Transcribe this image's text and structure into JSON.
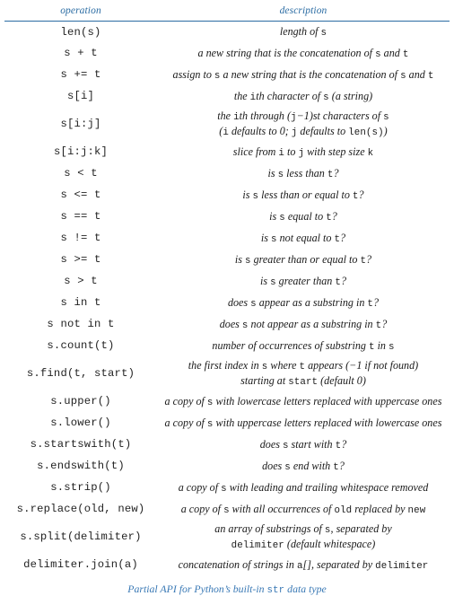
{
  "table": {
    "headers": {
      "operation": "operation",
      "description": "description"
    },
    "rows": [
      {
        "op": "len(s)",
        "desc_html": "length of <code class=\"m\">s</code>"
      },
      {
        "op": "s + t",
        "desc_html": "a new string that is the concatenation of <code class=\"m\">s</code> and <code class=\"m\">t</code>"
      },
      {
        "op": "s += t",
        "desc_html": "assign to <code class=\"m\">s</code> a new string that is the concatenation of <code class=\"m\">s</code> and <code class=\"m\">t</code>"
      },
      {
        "op": "s[i]",
        "desc_html": "the <code class=\"m\">i</code>th character of <code class=\"m\">s</code> (a string)"
      },
      {
        "op": "s[i:j]",
        "desc_html": "<span class=\"desc-line\">the <code class=\"m\">i</code>th through (<code class=\"m\">j</code>&#8722;1)st characters of <code class=\"m\">s</code></span><span class=\"desc-line\">(<code class=\"m\">i</code> defaults to 0; <code class=\"m\">j</code> defaults to <code class=\"m\">len(s)</code>)</span>",
        "tall": true
      },
      {
        "op": "s[i:j:k]",
        "desc_html": "slice from <code class=\"m\">i</code> to <code class=\"m\">j</code> with step size <code class=\"m\">k</code>"
      },
      {
        "op": "s < t",
        "desc_html": "is <code class=\"m\">s</code> less than <code class=\"m\">t</code>?"
      },
      {
        "op": "s <= t",
        "desc_html": "is <code class=\"m\">s</code> less than or equal to <code class=\"m\">t</code>?"
      },
      {
        "op": "s == t",
        "desc_html": "is <code class=\"m\">s</code> equal to <code class=\"m\">t</code>?"
      },
      {
        "op": "s != t",
        "desc_html": "is <code class=\"m\">s</code> not equal to <code class=\"m\">t</code>?"
      },
      {
        "op": "s >= t",
        "desc_html": "is <code class=\"m\">s</code> greater than or equal to <code class=\"m\">t</code>?"
      },
      {
        "op": "s > t",
        "desc_html": "is <code class=\"m\">s</code> greater than <code class=\"m\">t</code>?"
      },
      {
        "op": "s in t",
        "desc_html": "does <code class=\"m\">s</code> appear as a substring in <code class=\"m\">t</code>?"
      },
      {
        "op": "s not in t",
        "desc_html": "does <code class=\"m\">s</code> not appear as a substring in <code class=\"m\">t</code>?"
      },
      {
        "op": "s.count(t)",
        "desc_html": "number of occurrences of substring <code class=\"m\">t</code> in <code class=\"m\">s</code>"
      },
      {
        "op": "s.find(t, start)",
        "desc_html": "<span class=\"desc-line\">the first index in <code class=\"m\">s</code> where <code class=\"m\">t</code> appears (&#8722;1 if not found)</span><span class=\"desc-line\">starting at <code class=\"m\">start</code> (default 0)</span>",
        "tall": true
      },
      {
        "op": "s.upper()",
        "desc_html": "a copy of <code class=\"m\">s</code> with lowercase letters replaced with uppercase ones"
      },
      {
        "op": "s.lower()",
        "desc_html": "a copy of <code class=\"m\">s</code> with uppercase letters replaced with lowercase ones"
      },
      {
        "op": "s.startswith(t)",
        "desc_html": "does <code class=\"m\">s</code> start with <code class=\"m\">t</code>?"
      },
      {
        "op": "s.endswith(t)",
        "desc_html": "does <code class=\"m\">s</code> end with <code class=\"m\">t</code>?"
      },
      {
        "op": "s.strip()",
        "desc_html": "a copy of <code class=\"m\">s</code> with leading and trailing whitespace removed"
      },
      {
        "op": "s.replace(old, new)",
        "desc_html": "a copy of <code class=\"m\">s</code> with all occurrences of <code class=\"m\">old</code> replaced by <code class=\"m\">new</code>"
      },
      {
        "op": "s.split(delimiter)",
        "desc_html": "<span class=\"desc-line\">an array of substrings of <code class=\"m\">s</code>, separated by</span><span class=\"desc-line\"><code class=\"m\">delimiter</code> (default whitespace)</span>",
        "tall": true
      },
      {
        "op": "delimiter.join(a)",
        "desc_html": "concatenation of strings in <code class=\"m\">a</code>[], separated by <code class=\"m\">delimiter</code>"
      }
    ]
  },
  "caption": {
    "html": "Partial API for Python&#8217;s built-in <code class=\"m\">str</code> data type"
  },
  "colors": {
    "accent_blue": "#2b6ca3",
    "caption_blue": "#3a79b5",
    "text": "#1a1a1a",
    "background": "#ffffff"
  }
}
